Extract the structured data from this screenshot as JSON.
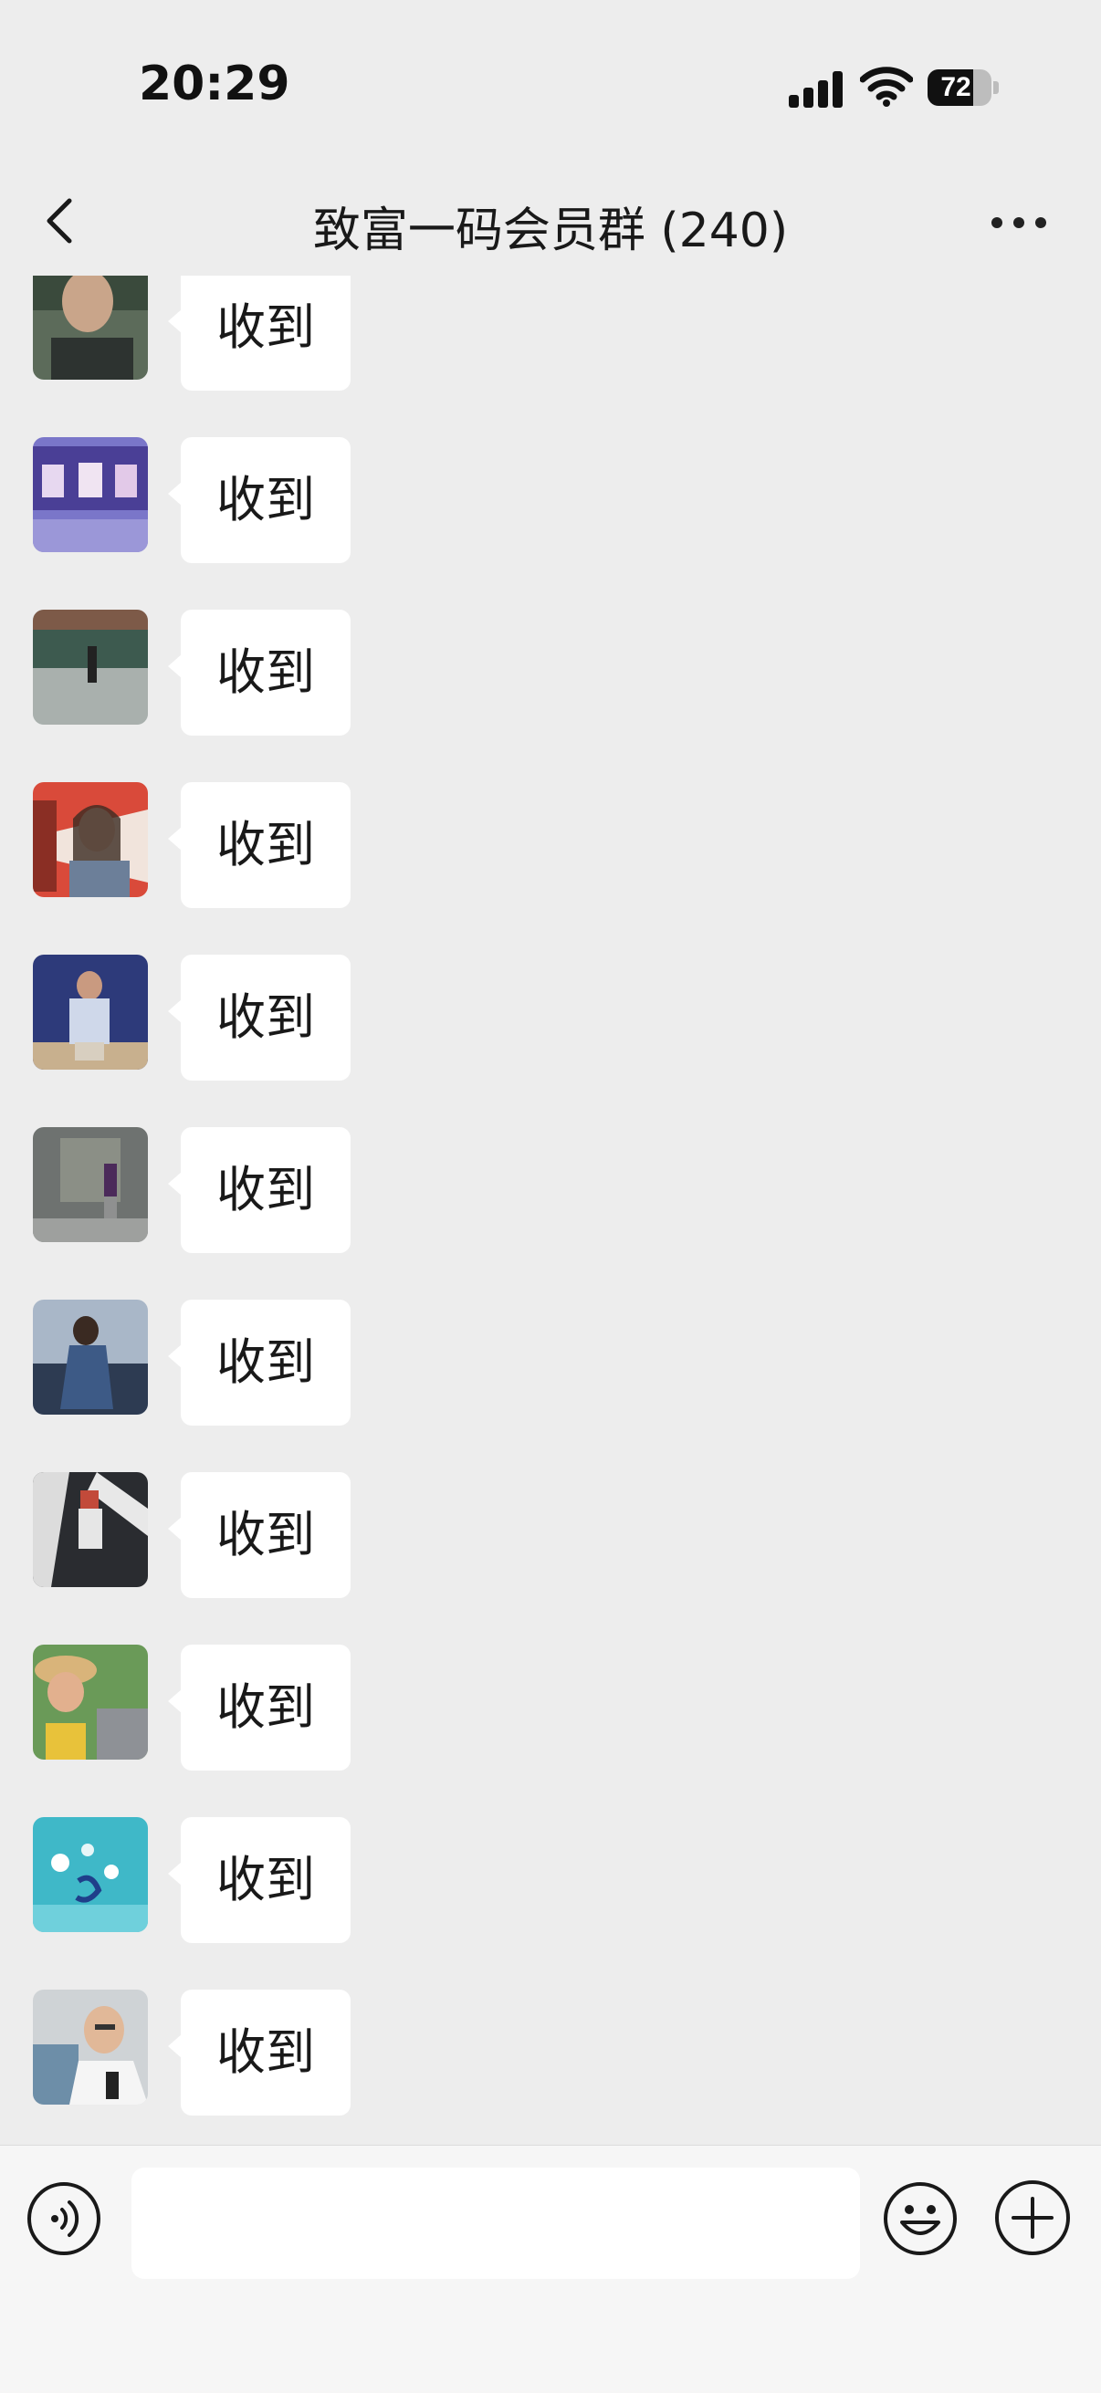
{
  "status_bar": {
    "time": "20:29",
    "battery_level": "72",
    "battery_percent": 72
  },
  "nav": {
    "title": "致富一码会员群 (240)",
    "back_icon": "chevron-left-icon",
    "more_icon": "more-dots-icon"
  },
  "messages": [
    {
      "text": "收到"
    },
    {
      "text": "收到"
    },
    {
      "text": "收到"
    },
    {
      "text": "收到"
    },
    {
      "text": "收到"
    },
    {
      "text": "收到"
    },
    {
      "text": "收到"
    },
    {
      "text": "收到"
    },
    {
      "text": "收到"
    },
    {
      "text": "收到"
    },
    {
      "text": "收到"
    }
  ],
  "input_bar": {
    "value": "",
    "voice_icon": "voice-icon",
    "emoji_icon": "emoji-icon",
    "plus_icon": "plus-circle-icon"
  },
  "colors": {
    "chat_background": "#EDEDED",
    "bubble": "#FFFFFF",
    "input_bar": "#F6F6F6"
  }
}
